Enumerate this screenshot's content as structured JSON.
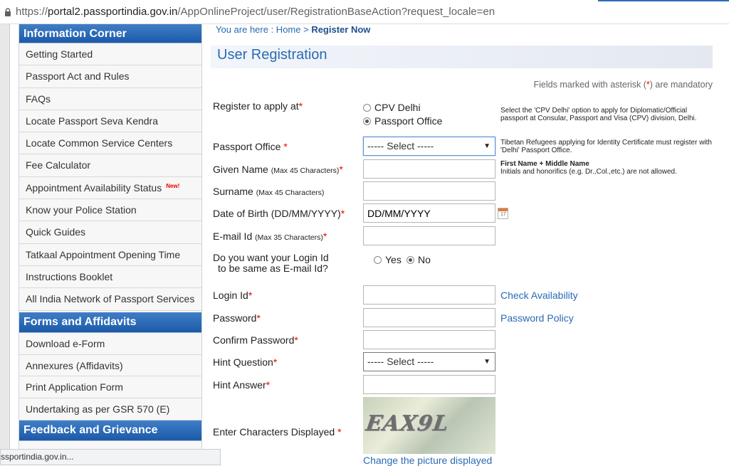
{
  "browser": {
    "url_prefix": "https://",
    "url_host": "portal2.passportindia.gov.in",
    "url_path": "/AppOnlineProject/user/RegistrationBaseAction?request_locale=en",
    "status_text": "ssportindia.gov.in..."
  },
  "sidebar": {
    "info_heading": "Information Corner",
    "info_items": [
      {
        "label": "Getting Started"
      },
      {
        "label": "Passport Act and Rules"
      },
      {
        "label": "FAQs"
      },
      {
        "label": "Locate Passport Seva Kendra"
      },
      {
        "label": "Locate Common Service Centers"
      },
      {
        "label": "Fee Calculator"
      },
      {
        "label": "Appointment Availability Status",
        "badge": "New!"
      },
      {
        "label": "Know your Police Station"
      },
      {
        "label": "Quick Guides"
      },
      {
        "label": "Tatkaal Appointment Opening Time"
      },
      {
        "label": "Instructions Booklet"
      },
      {
        "label": "All India Network of Passport Services"
      }
    ],
    "forms_heading": "Forms and Affidavits",
    "forms_items": [
      {
        "label": "Download e-Form"
      },
      {
        "label": "Annexures (Affidavits)"
      },
      {
        "label": "Print Application Form"
      },
      {
        "label": "Undertaking as per GSR 570 (E)"
      }
    ],
    "feedback_heading": "Feedback and Grievance"
  },
  "breadcrumb": {
    "prefix": "You are here : Home > ",
    "current": "Register Now"
  },
  "page_title": "User Registration",
  "mandatory_note": {
    "before": "Fields marked with asterisk (",
    "asterisk": "*",
    "after": ") are mandatory"
  },
  "form": {
    "register_at": {
      "label": "Register to apply at",
      "options": [
        "CPV Delhi",
        "Passport Office"
      ],
      "selected": "Passport Office",
      "hint": "Select the 'CPV Delhi' option to apply for Diplomatic/Official passport at Consular, Passport and Visa (CPV) division, Delhi."
    },
    "passport_office": {
      "label": "Passport Office ",
      "value": "----- Select -----",
      "hint": "Tibetan Refugees applying for Identity Certificate must register with 'Delhi' Passport Office."
    },
    "given_name": {
      "label": "Given Name ",
      "note": "(Max 45 Characters)",
      "hint_title": "First Name + Middle Name",
      "hint": "Initials and honorifics (e.g. Dr.,Col.,etc.) are not allowed."
    },
    "surname": {
      "label": "Surname ",
      "note": "(Max 45 Characters)"
    },
    "dob": {
      "label": "Date of Birth (DD/MM/YYYY)",
      "value": "DD/MM/YYYY",
      "cal_text": "17"
    },
    "email": {
      "label": "E-mail Id ",
      "note": "(Max 35 Characters)"
    },
    "login_same": {
      "label_line1": "Do you want your Login Id",
      "label_line2": "to be same as E-mail Id?",
      "options": [
        "Yes",
        "No"
      ],
      "selected": "No"
    },
    "login_id": {
      "label": "Login Id",
      "link": "Check Availability"
    },
    "password": {
      "label": "Password",
      "link": "Password Policy"
    },
    "confirm_password": {
      "label": "Confirm Password"
    },
    "hint_question": {
      "label": "Hint Question",
      "value": "----- Select -----"
    },
    "hint_answer": {
      "label": "Hint Answer"
    },
    "captcha": {
      "label": "Enter Characters Displayed ",
      "image_text": "EAX9L",
      "change_link": "Change the picture displayed"
    },
    "required_mark": "*"
  }
}
